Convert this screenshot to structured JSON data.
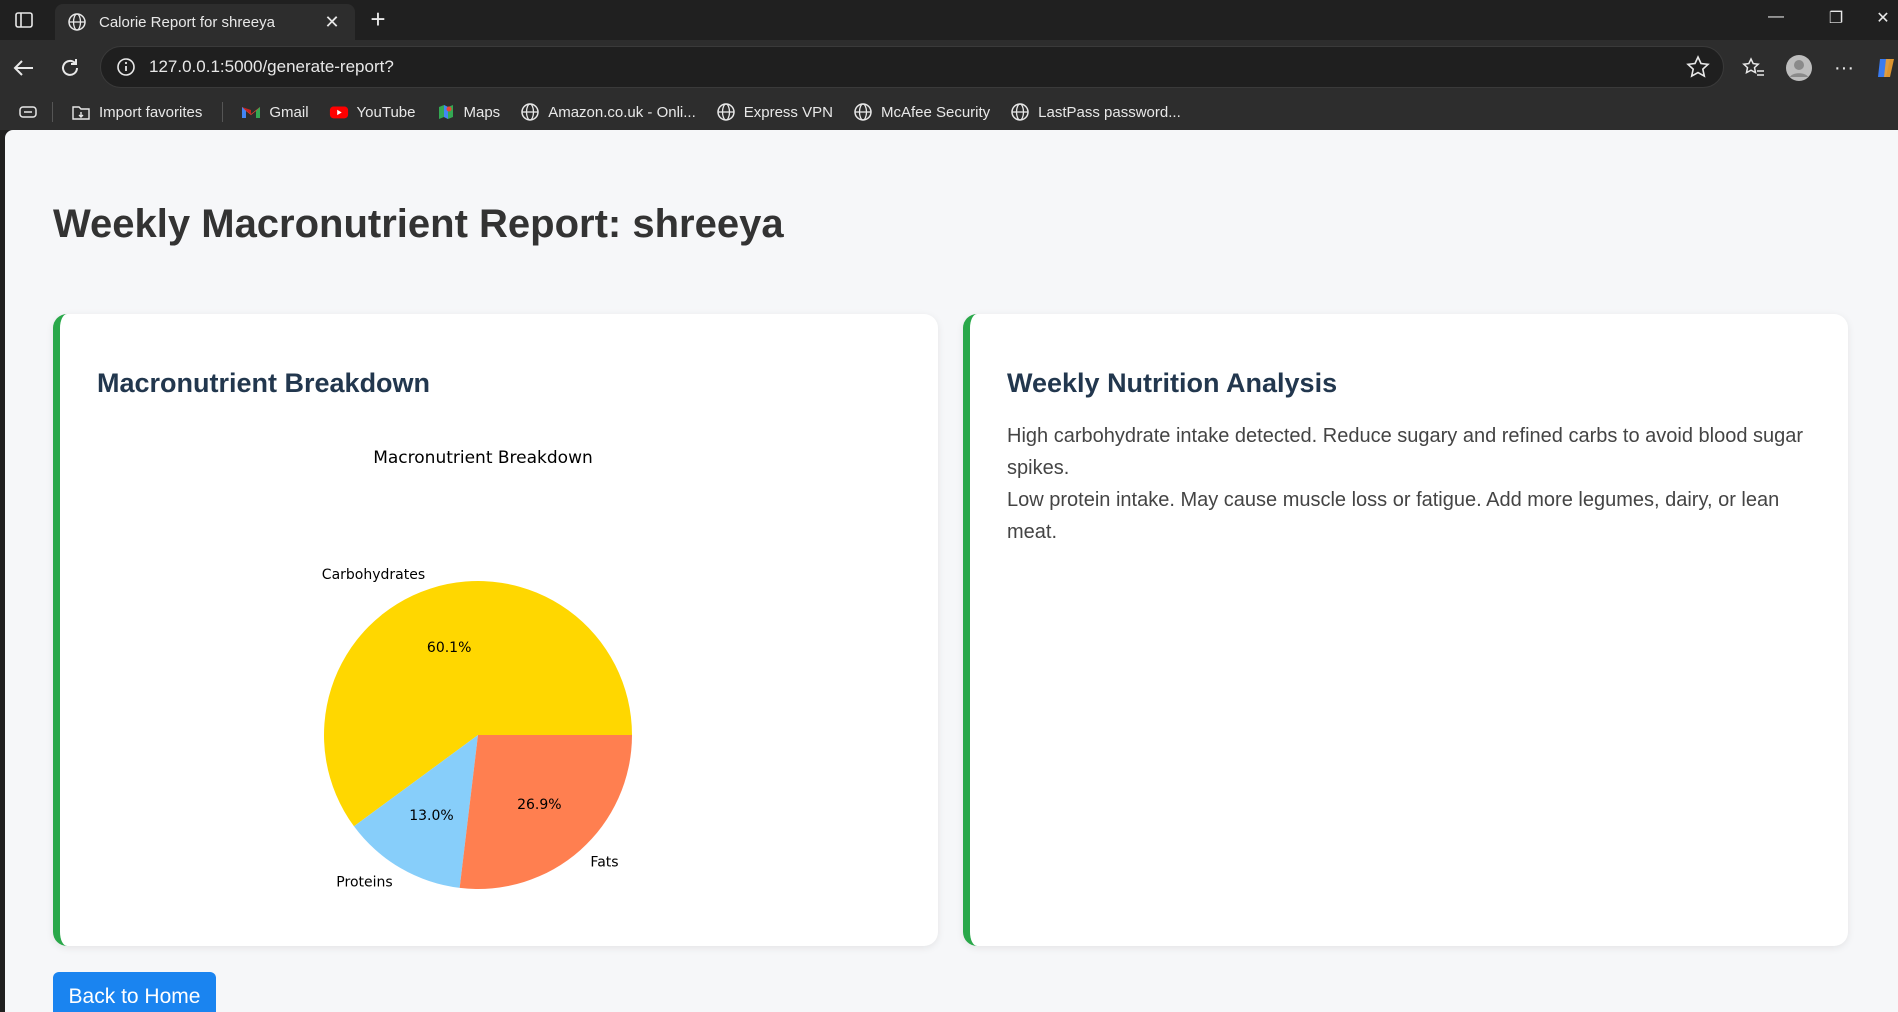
{
  "browser": {
    "tab_title": "Calorie Report for shreeya",
    "url": "127.0.0.1:5000/generate-report?",
    "bookmarks": [
      {
        "label": "Import favorites",
        "icon": "import-icon"
      },
      {
        "label": "Gmail",
        "icon": "gmail-icon"
      },
      {
        "label": "YouTube",
        "icon": "youtube-icon"
      },
      {
        "label": "Maps",
        "icon": "maps-icon"
      },
      {
        "label": "Amazon.co.uk - Onli...",
        "icon": "globe-icon"
      },
      {
        "label": "Express VPN",
        "icon": "globe-icon"
      },
      {
        "label": "McAfee Security",
        "icon": "globe-icon"
      },
      {
        "label": "LastPass password...",
        "icon": "globe-icon"
      }
    ]
  },
  "page": {
    "title": "Weekly Macronutrient Report: shreeya",
    "breakdown_heading": "Macronutrient Breakdown",
    "analysis_heading": "Weekly Nutrition Analysis",
    "analysis_lines": [
      "High carbohydrate intake detected. Reduce sugary and refined carbs to avoid blood sugar spikes.",
      "Low protein intake. May cause muscle loss or fatigue. Add more legumes, dairy, or lean meat."
    ],
    "back_button": "Back to Home"
  },
  "colors": {
    "accent_border": "#2aa84a",
    "button": "#1a84f0",
    "carbohydrates": "#ffd700",
    "proteins": "#87cefa",
    "fats": "#ff7f50"
  },
  "chart_data": {
    "type": "pie",
    "title": "Macronutrient Breakdown",
    "categories": [
      "Carbohydrates",
      "Proteins",
      "Fats"
    ],
    "values": [
      60.1,
      13.0,
      26.9
    ],
    "value_labels": [
      "60.1%",
      "13.0%",
      "26.9%"
    ],
    "colors": [
      "#ffd700",
      "#87cefa",
      "#ff7f50"
    ]
  }
}
